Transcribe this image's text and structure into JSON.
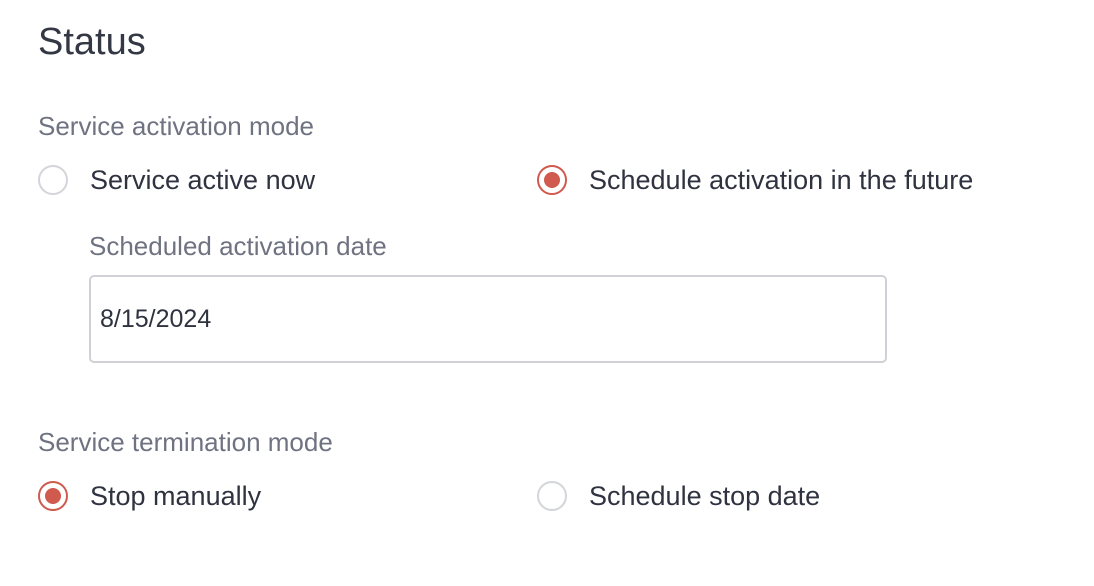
{
  "title": "Status",
  "activation": {
    "label": "Service activation mode",
    "options": [
      {
        "label": "Service active now",
        "checked": false
      },
      {
        "label": "Schedule activation in the future",
        "checked": true
      }
    ],
    "date_label": "Scheduled activation date",
    "date_value": "8/15/2024"
  },
  "termination": {
    "label": "Service termination mode",
    "options": [
      {
        "label": "Stop manually",
        "checked": true
      },
      {
        "label": "Schedule stop date",
        "checked": false
      }
    ]
  },
  "colors": {
    "accent": "#cf5a4d",
    "label": "#6f7381",
    "text": "#2f3340",
    "border": "#cfd1d6"
  }
}
